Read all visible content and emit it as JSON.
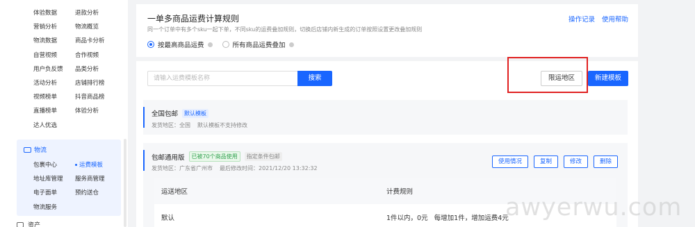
{
  "sidebar": {
    "grid": [
      [
        "体验数据",
        "退款分析"
      ],
      [
        "营销分析",
        "物流概览"
      ],
      [
        "物流数据",
        "商品卡分析"
      ],
      [
        "自营视频",
        "合作视频"
      ],
      [
        "用户负反馈",
        "品类分析"
      ],
      [
        "活动分析",
        "店铺排行榜"
      ],
      [
        "视频榜单",
        "抖音商品榜"
      ],
      [
        "直播榜单",
        "体验分析"
      ],
      [
        "达人优选",
        ""
      ]
    ],
    "logistics": {
      "title": "物流",
      "grid": [
        [
          "包裹中心",
          "运费模板"
        ],
        [
          "地址库管理",
          "服务商管理"
        ],
        [
          "电子面单",
          "预约送仓"
        ],
        [
          "物流服务",
          ""
        ]
      ],
      "active": "运费模板"
    },
    "bottom_label": "资产"
  },
  "rules": {
    "title": "一单多商品运费计算规则",
    "subtitle": "同一个订单中有多个sku一起下单，不同sku的运费叠加规则，切换后店铺内新生成的订单按照设置更改叠加规则",
    "links": [
      "操作记录",
      "使用帮助"
    ],
    "options": [
      {
        "label": "按最高商品运费",
        "checked": true
      },
      {
        "label": "所有商品运费叠加",
        "checked": false
      }
    ]
  },
  "toolbar": {
    "search_placeholder": "请输入运费模板名称",
    "search_label": "搜索",
    "limit_label": "限运地区",
    "new_label": "新建模板"
  },
  "templates": [
    {
      "name": "全国包邮",
      "tags": [
        "默认模板"
      ],
      "info": [
        "发货地区：全国",
        "默认模板不支持修改"
      ]
    },
    {
      "name": "包邮通用版",
      "tags": [
        "已被70个商品使用",
        "指定条件包邮"
      ],
      "info": [
        "发货地区：广东省广州市",
        "最后修改时间：2021/12/20 13:32:32"
      ],
      "actions": [
        "使用情况",
        "复制",
        "修改",
        "删除"
      ]
    }
  ],
  "table": {
    "headers": [
      "运送地区",
      "计费规则"
    ],
    "rows": [
      [
        "默认",
        "1件以内，0元   每增加1件，增加运费4元"
      ]
    ]
  },
  "watermark": "awyerwu.com"
}
